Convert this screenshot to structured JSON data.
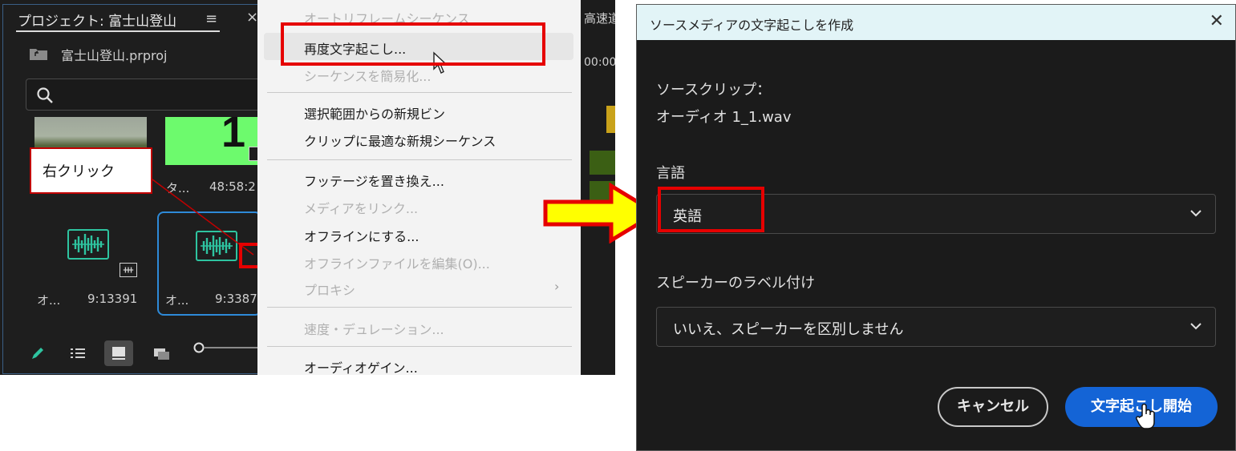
{
  "project_panel": {
    "title": "プロジェクト: 富士山登山",
    "menu_glyph": "≡",
    "close_glyph": "×",
    "file_name": "富士山登山.prproj",
    "thumbs": [
      {
        "label_left": "タ...",
        "label_right": "48:58:2"
      },
      {
        "big_text": "1"
      }
    ],
    "audio_items": [
      {
        "name": "オ...",
        "duration": "9:13391"
      },
      {
        "name": "オ...",
        "duration": "9:3387"
      }
    ]
  },
  "callout": {
    "text": "右クリック"
  },
  "timeline_fragment": {
    "text": "高速道",
    "time": "00:00"
  },
  "context_menu": {
    "items": [
      {
        "label": "オートリフレームシーケンス",
        "disabled": true
      },
      {
        "label": "再度文字起こし...",
        "disabled": false
      },
      {
        "label": "シーケンスを簡易化...",
        "disabled": true
      },
      {
        "label": "選択範囲からの新規ビン",
        "disabled": false
      },
      {
        "label": "クリップに最適な新規シーケンス",
        "disabled": false
      },
      {
        "label": "フッテージを置き換え...",
        "disabled": false
      },
      {
        "label": "メディアをリンク...",
        "disabled": true
      },
      {
        "label": "オフラインにする...",
        "disabled": false
      },
      {
        "label": "オフラインファイルを編集(O)...",
        "disabled": true
      },
      {
        "label": "プロキシ",
        "disabled": true
      },
      {
        "label": "速度・デュレーション...",
        "disabled": true
      },
      {
        "label": "オーディオゲイン...",
        "disabled": false
      }
    ],
    "submenu_arrow": "›"
  },
  "dialog": {
    "title": "ソースメディアの文字起こしを作成",
    "close_glyph": "✕",
    "source_clip_label": "ソースクリップ：",
    "source_clip_value": "オーディオ 1_1.wav",
    "language_label": "言語",
    "language_value": "英語",
    "speaker_label": "スピーカーのラベル付け",
    "speaker_value": "いいえ、スピーカーを区別しません",
    "cancel_button": "キャンセル",
    "start_button": "文字起こし開始"
  },
  "colors": {
    "highlight_red": "#e60000",
    "arrow_yellow": "#ffff00",
    "primary_blue": "#1464d6",
    "audio_green": "#2ec4a0"
  }
}
